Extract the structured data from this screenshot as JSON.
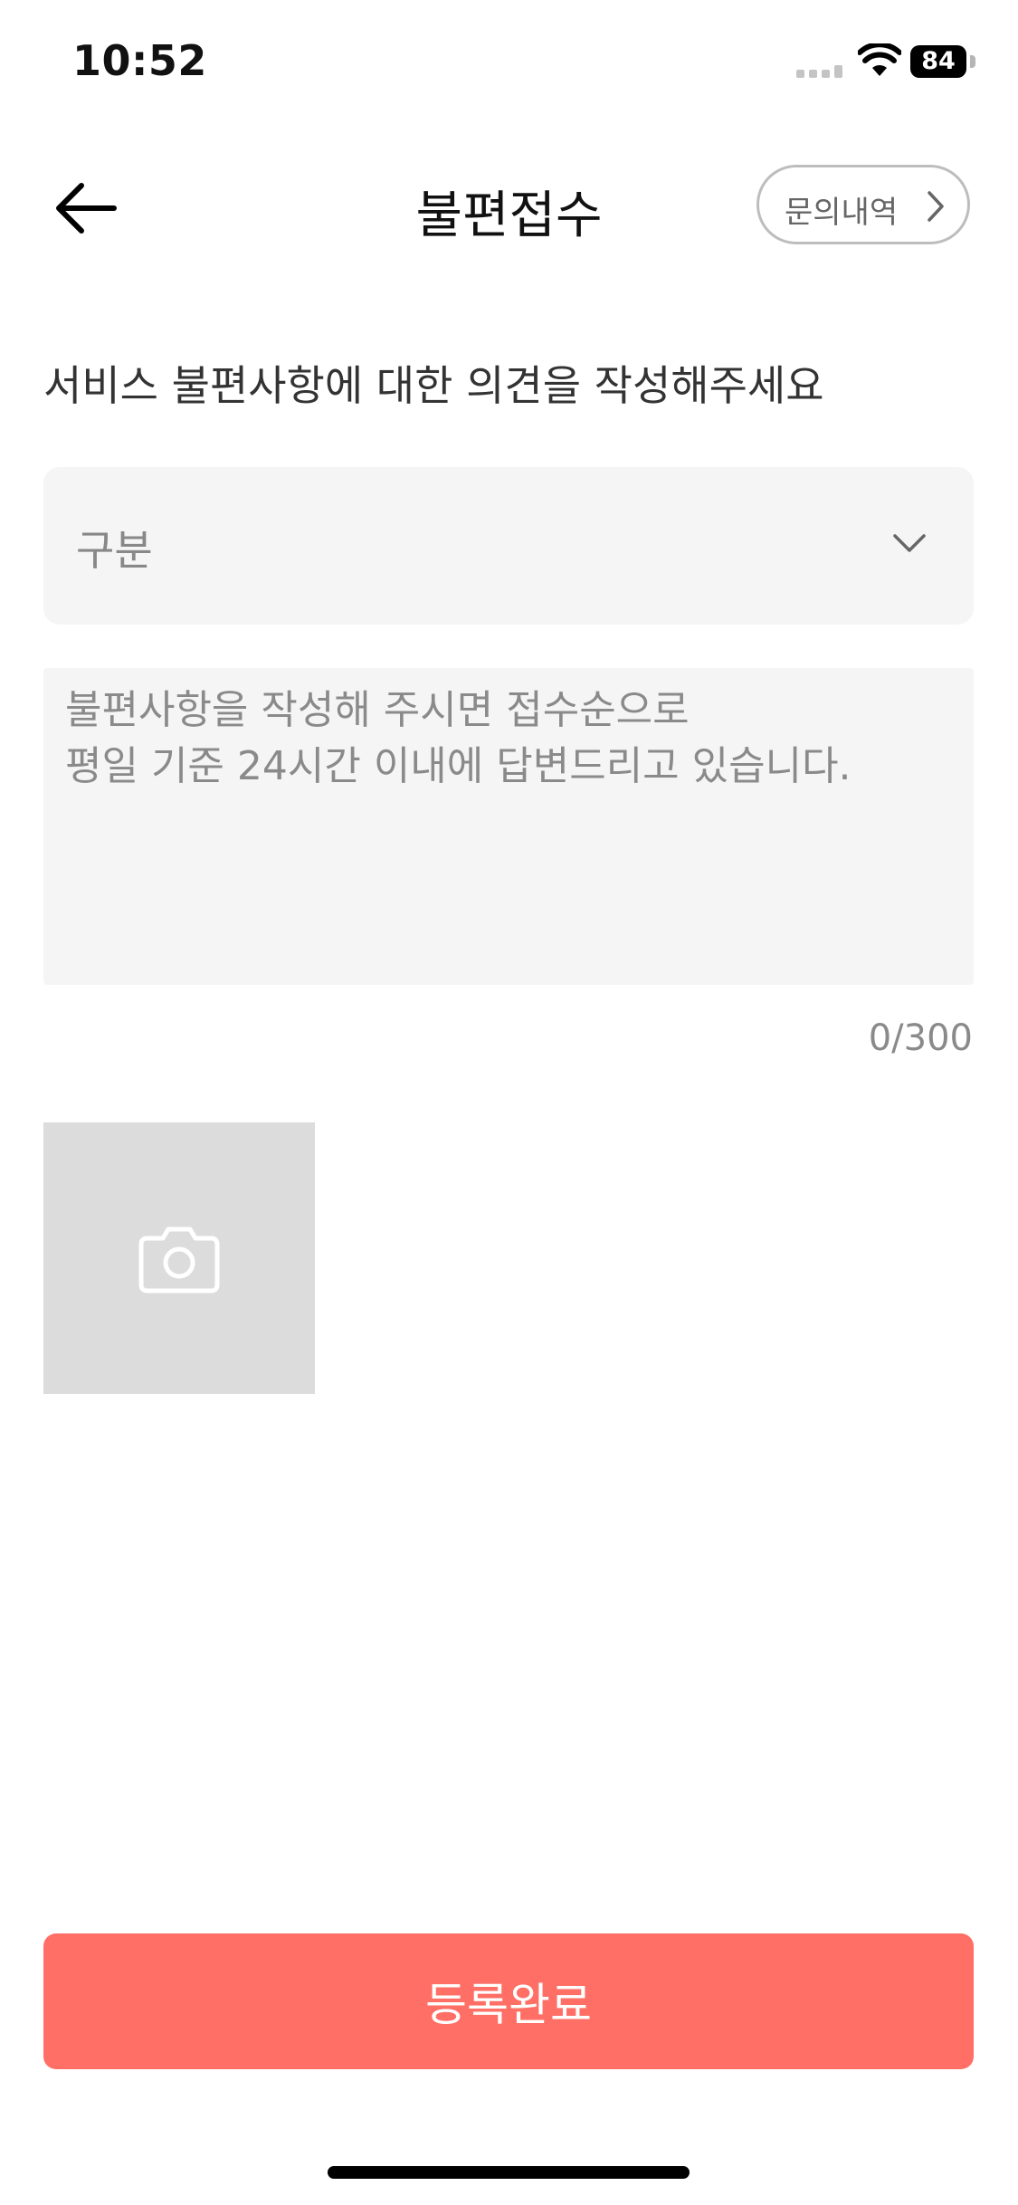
{
  "status_bar": {
    "time": "10:52",
    "battery": "84",
    "icons": [
      "cell-signal-icon",
      "wifi-icon",
      "battery-icon"
    ]
  },
  "header": {
    "title": "불편접수",
    "back_icon": "arrow-left-icon",
    "history_button_label": "문의내역",
    "history_icon": "chevron-right-icon"
  },
  "form": {
    "guide_text": "서비스 불편사항에 대한 의견을 작성해주세요",
    "category": {
      "placeholder": "구분",
      "icon": "chevron-down-icon"
    },
    "content": {
      "value": "",
      "placeholder": "불편사항을 작성해 주시면 접수순으로\n평일 기준 24시간 이내에 답변드리고 있습니다."
    },
    "char_count": "0/300",
    "photo": {
      "icon": "camera-icon"
    },
    "submit_label": "등록완료"
  },
  "colors": {
    "accent": "#ff6f66",
    "field_background": "#f5f5f5",
    "photo_background": "#dcdcdc",
    "placeholder_text": "#8a8a8a"
  }
}
